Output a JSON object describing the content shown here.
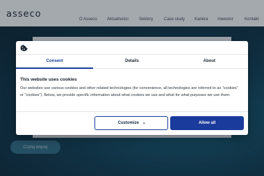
{
  "site": {
    "logo": "asseco",
    "nav": [
      "O Asseco",
      "Aktualności",
      "Sektory",
      "Case study",
      "Kariera",
      "Inwestor",
      "Kontakt"
    ],
    "hero_button": "Czytaj więcej"
  },
  "consent": {
    "tabs": [
      "Consent",
      "Details",
      "About"
    ],
    "active_tab": "Consent",
    "title": "This website uses cookies",
    "body": "Our websites use various cookies and other related technologies (for convenience, all technologies are referred to as \"cookies\" or \"cookies\"). Below, we provide specific information about what cookies we use and what for what purposes we use them.",
    "customize_label": "Customize",
    "allow_label": "Allow all"
  },
  "colors": {
    "accent": "#1a3a9c",
    "hero_bg": "#0f3e55"
  },
  "icons": {
    "cookie": "cookie-icon",
    "chevron": "chevron-right-icon"
  }
}
